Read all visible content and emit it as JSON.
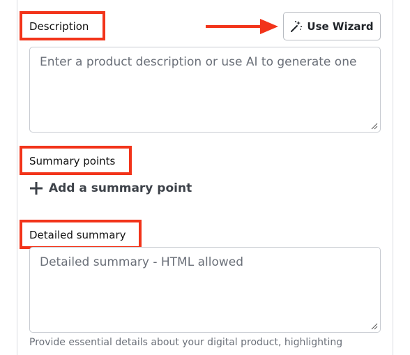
{
  "description": {
    "label": "Description",
    "wizard_button_label": "Use Wizard",
    "placeholder": "Enter a product description or use AI to generate one"
  },
  "summary_points": {
    "label": "Summary points",
    "add_label": "Add a summary point"
  },
  "detailed_summary": {
    "label": "Detailed summary",
    "placeholder": "Detailed summary - HTML allowed",
    "help_text": "Provide essential details about your digital product, highlighting"
  },
  "colors": {
    "highlight": "#f2341a",
    "border": "#c7cbd1"
  }
}
